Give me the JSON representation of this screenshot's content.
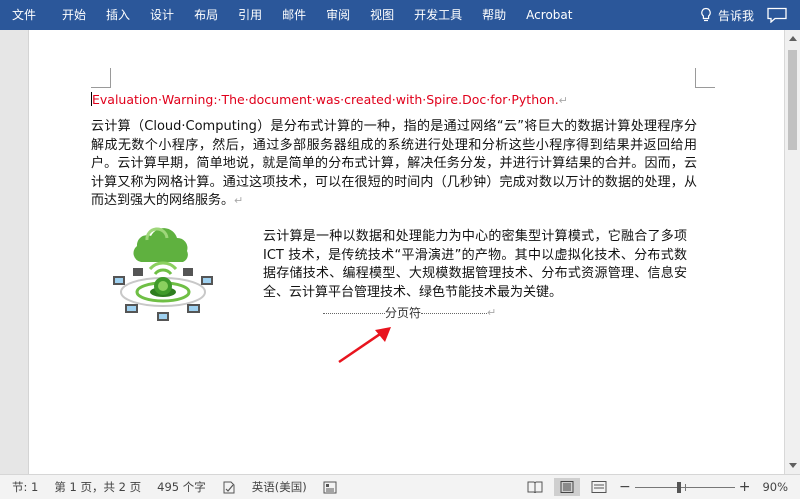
{
  "ribbon": {
    "tabs": [
      "文件",
      "开始",
      "插入",
      "设计",
      "布局",
      "引用",
      "邮件",
      "审阅",
      "视图",
      "开发工具",
      "帮助",
      "Acrobat"
    ],
    "tell_me": "告诉我"
  },
  "document": {
    "warning": "Evaluation·Warning:·The·document·was·created·with·Spire.Doc·for·Python.",
    "para1": "云计算（Cloud·Computing）是分布式计算的一种，指的是通过网络“云”将巨大的数据计算处理程序分解成无数个小程序，然后，通过多部服务器组成的系统进行处理和分析这些小程序得到结果并返回给用户。云计算早期，简单地说，就是简单的分布式计算，解决任务分发，并进行计算结果的合并。因而，云计算又称为网格计算。通过这项技术，可以在很短的时间内（几秒钟）完成对数以万计的数据的处理，从而达到强大的网络服务。",
    "para2": " 云计算是一种以数据和处理能力为中心的密集型计算模式，它融合了多项 ICT 技术，是传统技术“平滑演进”的产物。其中以虚拟化技术、分布式数据存储技术、编程模型、大规模数据管理技术、分布式资源管理、信息安全、云计算平台管理技术、绿色节能技术最为关键。",
    "page_break_label": "分页符",
    "para_mark": "↵",
    "image_icon": "cloud-computing-illustration",
    "annotation_icon": "red-arrow"
  },
  "status": {
    "section": "节: 1",
    "page": "第 1 页，共 2 页",
    "words": "495 个字",
    "language": "英语(美国)",
    "zoom": "90%",
    "zoom_level": 0.9
  },
  "colors": {
    "ribbon": "#2b579a",
    "warning": "#e0001b",
    "arrow": "#e8141e"
  }
}
